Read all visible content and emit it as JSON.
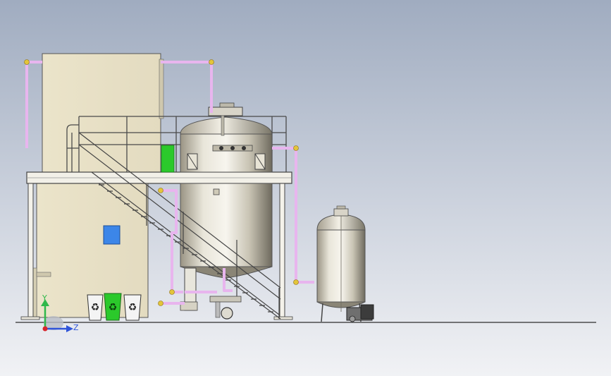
{
  "viewport": {
    "background_top": "#a0acc0",
    "background_bottom": "#f1f2f5"
  },
  "triad": {
    "y_label": "Y",
    "z_label": "Z",
    "y_axis_color": "#2fb84a",
    "z_axis_color": "#2f54d9",
    "origin_color": "#d8262e"
  },
  "colors": {
    "building_wall": "#eae2c8",
    "steel": "#d9d6ca",
    "pipe": "#e8b5ee",
    "pipe_joint": "#e3c53a",
    "blue_panel": "#3c86e8",
    "green_bin": "#2bc92b",
    "frame": "#3a3a3a"
  },
  "icons": {
    "recycle_bin_white": "recycle-icon",
    "recycle_bin_green": "recycle-icon"
  }
}
